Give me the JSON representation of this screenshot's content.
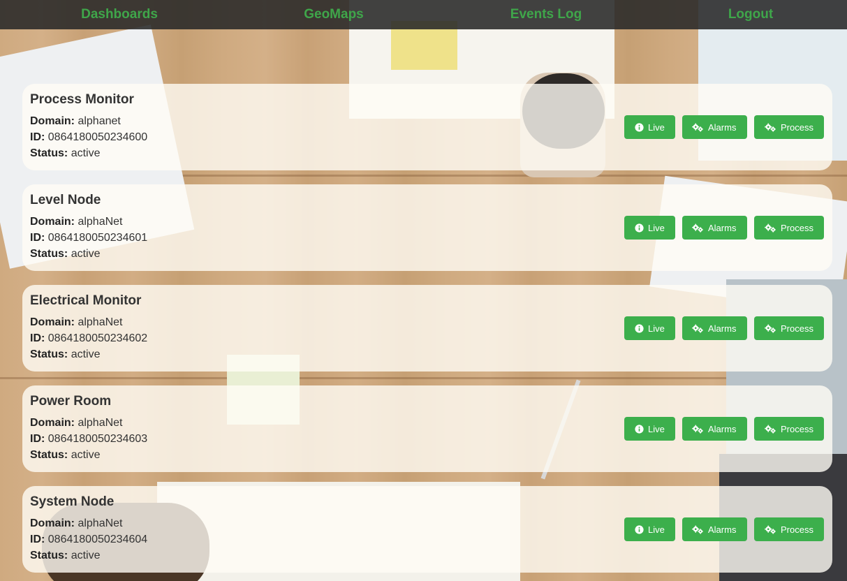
{
  "nav": {
    "items": [
      {
        "label": "Dashboards"
      },
      {
        "label": "GeoMaps"
      },
      {
        "label": "Events Log"
      },
      {
        "label": "Logout"
      }
    ]
  },
  "labels": {
    "domain": "Domain:",
    "id": "ID:",
    "status": "Status:"
  },
  "buttons": {
    "live": "Live",
    "alarms": "Alarms",
    "process": "Process"
  },
  "devices": [
    {
      "name": "Process Monitor",
      "domain": "alphanet",
      "id": "0864180050234600",
      "status": "active"
    },
    {
      "name": "Level Node",
      "domain": "alphaNet",
      "id": "0864180050234601",
      "status": "active"
    },
    {
      "name": "Electrical Monitor",
      "domain": "alphaNet",
      "id": "0864180050234602",
      "status": "active"
    },
    {
      "name": "Power Room",
      "domain": "alphaNet",
      "id": "0864180050234603",
      "status": "active"
    },
    {
      "name": "System Node",
      "domain": "alphaNet",
      "id": "0864180050234604",
      "status": "active"
    }
  ],
  "colors": {
    "accent": "#3caf4c",
    "nav_text": "#3fa64a",
    "nav_bg": "#282828"
  },
  "icons": {
    "live": "info-circle-icon",
    "alarms": "gears-icon",
    "process": "gears-icon"
  }
}
